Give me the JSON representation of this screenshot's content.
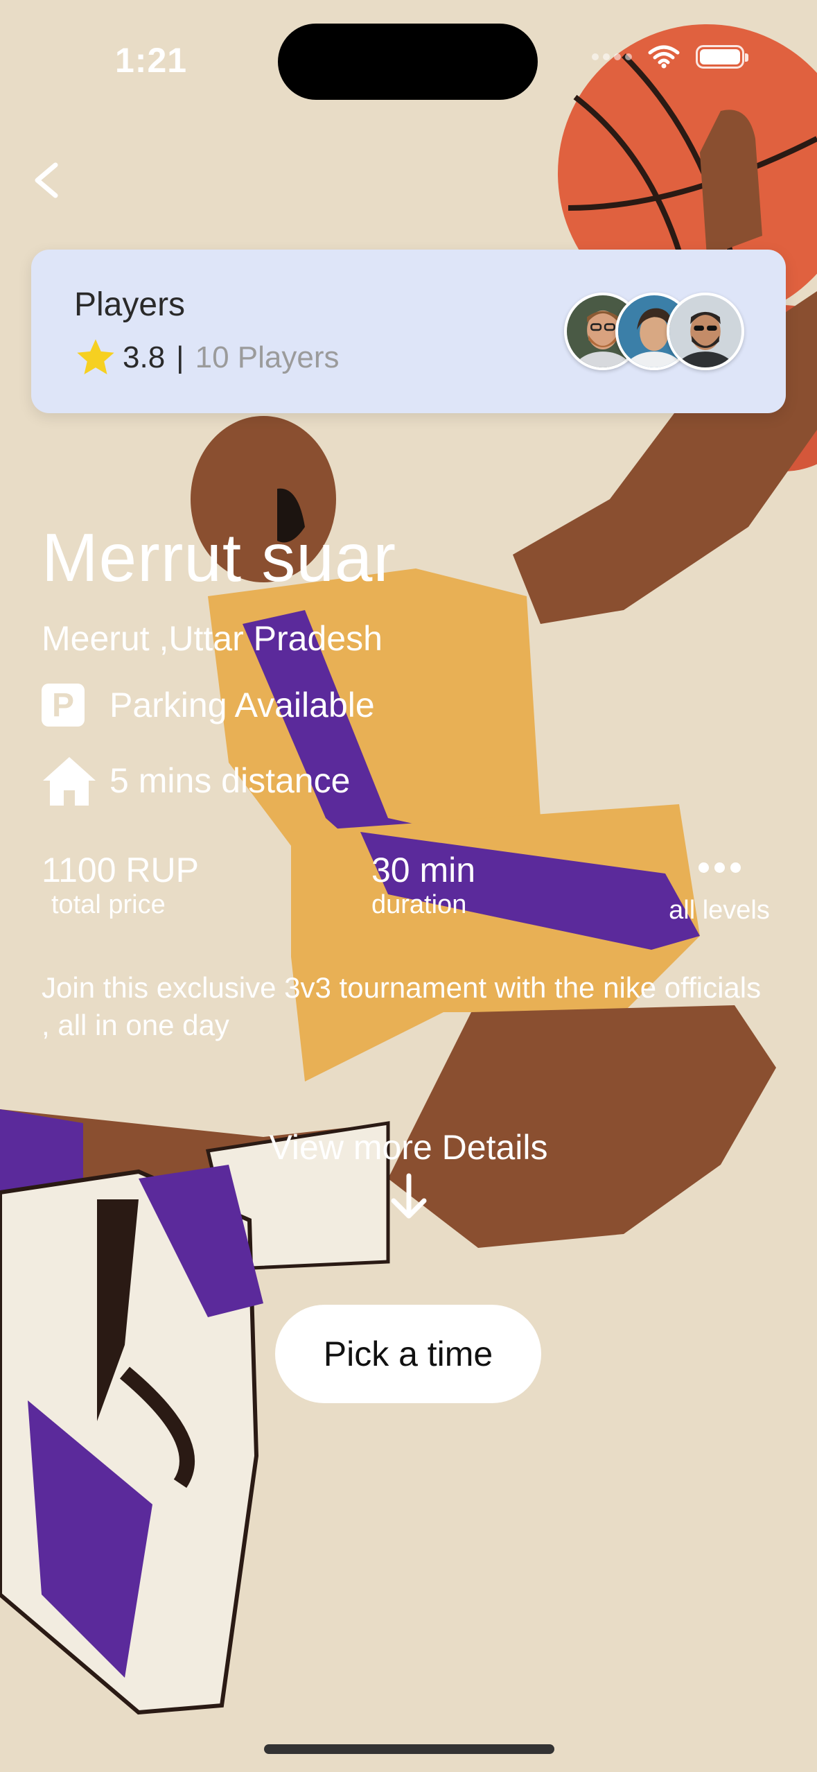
{
  "status_bar": {
    "time": "1:21"
  },
  "players_card": {
    "title": "Players",
    "rating": "3.8",
    "separator": "|",
    "players_count": "10 Players",
    "avatars": [
      "player-avatar-1",
      "player-avatar-2",
      "player-avatar-3"
    ]
  },
  "venue": {
    "title": "Merrut suar",
    "location": "Meerut ,Uttar Pradesh",
    "parking_icon_letter": "P",
    "parking": "Parking Available",
    "distance": "5 mins distance"
  },
  "stats": {
    "price_value": "1100 RUP",
    "price_label": "total price",
    "duration_value": "30 min",
    "duration_label": "duration",
    "levels_label": "all levels"
  },
  "description": "Join this exclusive 3v3 tournament with the nike officials , all in one day",
  "view_more": "View more Details",
  "cta": {
    "pick_time": "Pick a time"
  },
  "icons": {
    "back": "chevron-left-icon",
    "star": "star-icon",
    "parking": "parking-icon",
    "home": "home-icon",
    "more": "more-dots-icon",
    "arrow": "arrow-down-icon"
  },
  "colors": {
    "background": "#e8dcc6",
    "card": "#dee5f8",
    "star": "#f6d021",
    "ball": "#e0613f",
    "jersey_purple": "#5b2a9b",
    "jersey_gold": "#e8b055",
    "skin": "#8a4f30"
  }
}
